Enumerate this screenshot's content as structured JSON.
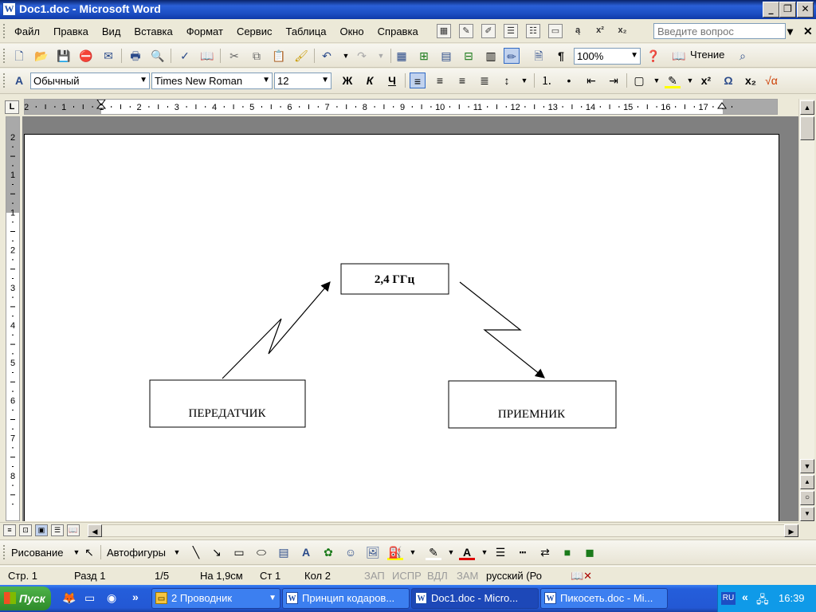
{
  "window": {
    "title": "Doc1.doc - Microsoft Word",
    "app_icon": "W"
  },
  "menu": {
    "items": [
      "Файл",
      "Правка",
      "Вид",
      "Вставка",
      "Формат",
      "Сервис",
      "Таблица",
      "Окно",
      "Справка"
    ],
    "ask_placeholder": "Введите вопрос"
  },
  "standard_toolbar": {
    "zoom": "100%",
    "reading_label": "Чтение"
  },
  "formatting_toolbar": {
    "style": "Обычный",
    "font": "Times New Roman",
    "size": "12",
    "bold": "Ж",
    "italic": "К",
    "underline": "Ч"
  },
  "ruler": {
    "h_ticks": [
      "2",
      "1",
      "1",
      "2",
      "3",
      "4",
      "5",
      "6",
      "7",
      "8",
      "9",
      "10",
      "11",
      "12",
      "13",
      "14",
      "15",
      "16",
      "17"
    ],
    "v_ticks": [
      "2",
      "1",
      "1",
      "2",
      "3",
      "4",
      "5",
      "6",
      "7",
      "8"
    ],
    "corner": "L"
  },
  "document": {
    "freq_label": "2,4 ГГц",
    "transmitter_label": "ПЕРЕДАТЧИК",
    "receiver_label": "ПРИЕМНИК"
  },
  "drawing_toolbar": {
    "drawing_label": "Рисование",
    "autoshapes_label": "Автофигуры"
  },
  "status": {
    "page": "Стр.  1",
    "section": "Разд  1",
    "pages": "1/5",
    "at": "На 1,9см",
    "line": "Ст  1",
    "col": "Кол  2",
    "rec": "ЗАП",
    "trk": "ИСПР",
    "ext": "ВДЛ",
    "ovr": "ЗАМ",
    "lang": "русский (Ро"
  },
  "taskbar": {
    "start": "Пуск",
    "tasks": [
      "2 Проводник",
      "Принцип кодаров...",
      "Doc1.doc - Micro...",
      "Пикосеть.doc - Mi..."
    ],
    "lang": "RU",
    "clock": "16:39"
  }
}
